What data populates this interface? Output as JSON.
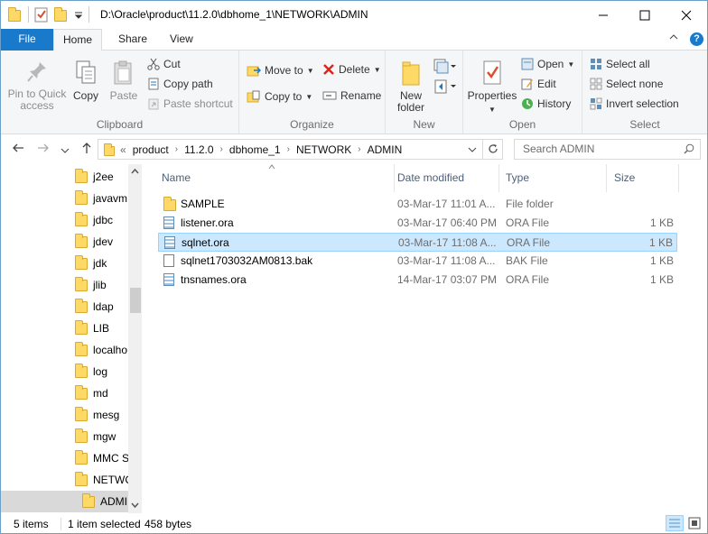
{
  "window": {
    "title": "D:\\Oracle\\product\\11.2.0\\dbhome_1\\NETWORK\\ADMIN",
    "minimize_icon": "minimize-icon",
    "maximize_icon": "maximize-icon",
    "close_icon": "close-icon"
  },
  "ribbon_tabs": [
    "File",
    "Home",
    "Share",
    "View"
  ],
  "ribbon": {
    "clipboard": {
      "label": "Clipboard",
      "pin_label_1": "Pin to Quick",
      "pin_label_2": "access",
      "copy_label": "Copy",
      "paste_label": "Paste",
      "cut_label": "Cut",
      "copy_path_label": "Copy path",
      "paste_shortcut_label": "Paste shortcut"
    },
    "organize": {
      "label": "Organize",
      "move_to_label": "Move to",
      "copy_to_label": "Copy to",
      "delete_label": "Delete",
      "rename_label": "Rename"
    },
    "new": {
      "label": "New",
      "new_folder_label_1": "New",
      "new_folder_label_2": "folder"
    },
    "open": {
      "label": "Open",
      "properties_label": "Properties",
      "open_label": "Open",
      "edit_label": "Edit",
      "history_label": "History"
    },
    "select": {
      "label": "Select",
      "select_all_label": "Select all",
      "select_none_label": "Select none",
      "invert_label": "Invert selection"
    }
  },
  "address": {
    "prefix": "«",
    "crumbs": [
      "product",
      "11.2.0",
      "dbhome_1",
      "NETWORK",
      "ADMIN"
    ],
    "search_placeholder": "Search ADMIN"
  },
  "tree": [
    "j2ee",
    "javavm",
    "jdbc",
    "jdev",
    "jdk",
    "jlib",
    "ldap",
    "LIB",
    "localho",
    "log",
    "md",
    "mesg",
    "mgw",
    "MMC S",
    "NETWC",
    "ADMI"
  ],
  "columns": {
    "name": "Name",
    "date": "Date modified",
    "type": "Type",
    "size": "Size"
  },
  "files": [
    {
      "name": "SAMPLE",
      "date": "03-Mar-17 11:01 A...",
      "type": "File folder",
      "size": "",
      "icon": "folder-icon"
    },
    {
      "name": "listener.ora",
      "date": "03-Mar-17 06:40 PM",
      "type": "ORA File",
      "size": "1 KB",
      "icon": "ora-file-icon"
    },
    {
      "name": "sqlnet.ora",
      "date": "03-Mar-17 11:08 A...",
      "type": "ORA File",
      "size": "1 KB",
      "icon": "ora-file-icon"
    },
    {
      "name": "sqlnet1703032AM0813.bak",
      "date": "03-Mar-17 11:08 A...",
      "type": "BAK File",
      "size": "1 KB",
      "icon": "file-icon"
    },
    {
      "name": "tnsnames.ora",
      "date": "14-Mar-17 03:07 PM",
      "type": "ORA File",
      "size": "1 KB",
      "icon": "ora-file-icon"
    }
  ],
  "status": {
    "count": "5 items",
    "selected": "1 item selected",
    "size": "458 bytes"
  },
  "colors": {
    "accent": "#1979ca",
    "selection": "#cce8ff"
  }
}
